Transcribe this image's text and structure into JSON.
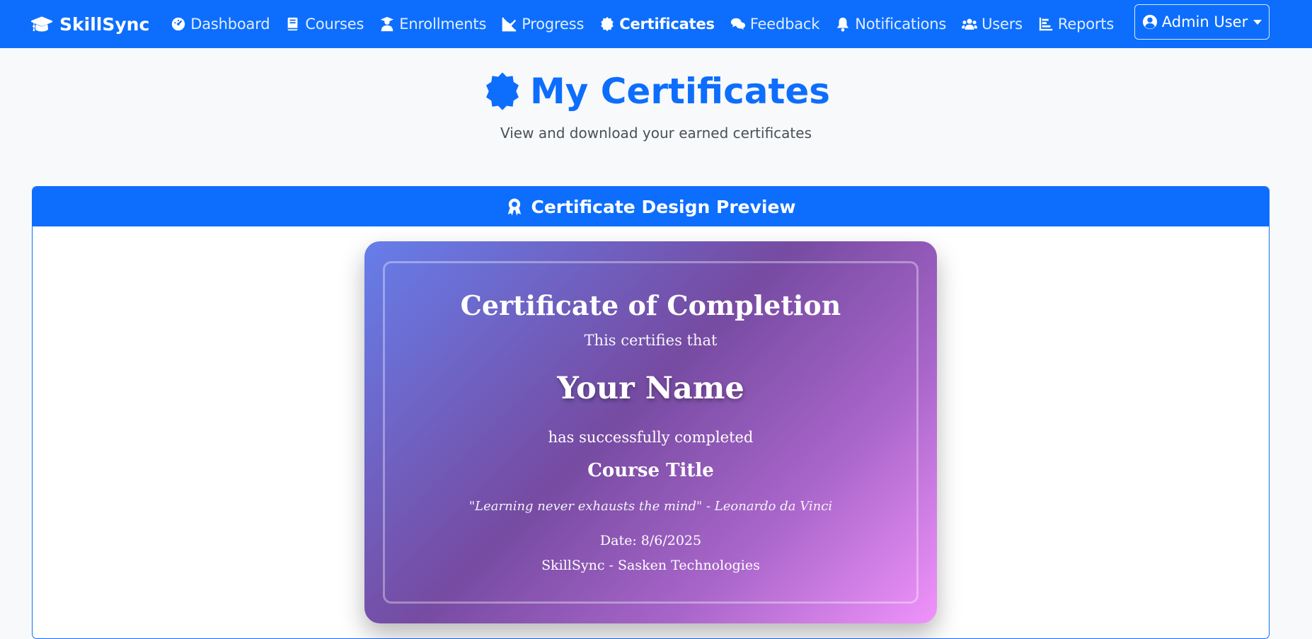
{
  "navbar": {
    "brand": "SkillSync",
    "items": [
      {
        "label": "Dashboard",
        "icon": "dashboard-icon",
        "active": false
      },
      {
        "label": "Courses",
        "icon": "book-icon",
        "active": false
      },
      {
        "label": "Enrollments",
        "icon": "user-graduate-icon",
        "active": false
      },
      {
        "label": "Progress",
        "icon": "line-chart-icon",
        "active": false
      },
      {
        "label": "Certificates",
        "icon": "certificate-icon",
        "active": true
      },
      {
        "label": "Feedback",
        "icon": "comments-icon",
        "active": false
      },
      {
        "label": "Notifications",
        "icon": "bell-icon",
        "active": false
      },
      {
        "label": "Users",
        "icon": "users-icon",
        "active": false
      },
      {
        "label": "Reports",
        "icon": "bar-chart-icon",
        "active": false
      }
    ],
    "user_menu": {
      "label": "Admin User",
      "icon": "user-circle-icon"
    }
  },
  "page": {
    "title": "My Certificates",
    "subtitle": "View and download your earned certificates"
  },
  "preview": {
    "header": "Certificate Design Preview",
    "certificate": {
      "title": "Certificate of Completion",
      "line1": "This certifies that",
      "name": "Your Name",
      "line2": "has successfully completed",
      "course": "Course Title",
      "quote": "\"Learning never exhausts the mind\" - Leonardo da Vinci",
      "date": "Date: 8/6/2025",
      "organization": "SkillSync - Sasken Technologies"
    }
  },
  "colors": {
    "primary": "#0d6efd",
    "background": "#f8f9fa",
    "gradient_start": "#667eea",
    "gradient_mid": "#764ba2",
    "gradient_end": "#f093fb"
  }
}
